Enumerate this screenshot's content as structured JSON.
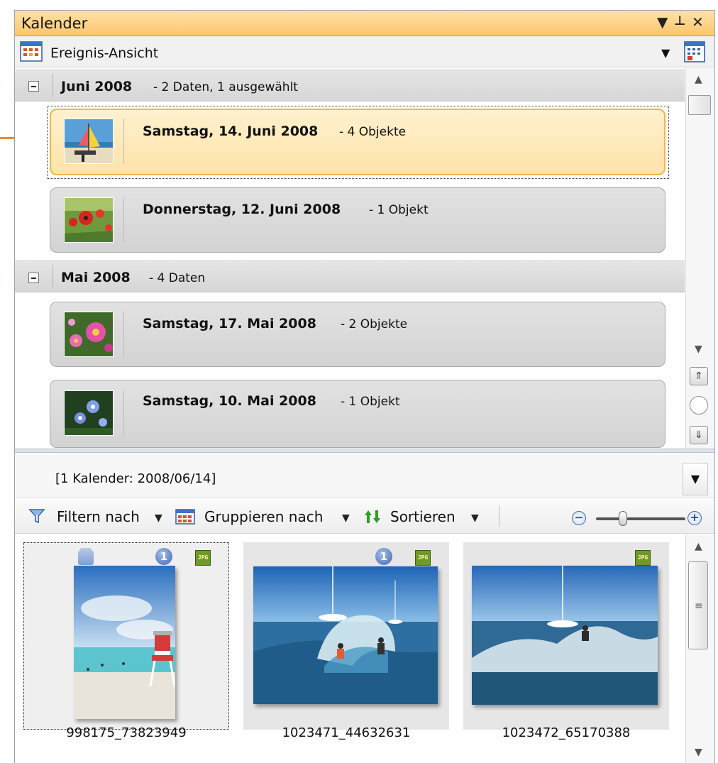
{
  "window": {
    "title": "Kalender",
    "controls": [
      "▼",
      "⊥",
      "✕"
    ]
  },
  "view_selector": {
    "value": "Ereignis-Ansicht"
  },
  "groups": [
    {
      "title": "Juni 2008",
      "summary": "- 2 Daten, 1 ausgewählt",
      "dates": [
        {
          "title": "Samstag, 14. Juni 2008",
          "count": "- 4 Objekte",
          "selected": true,
          "thumb": "beach-sailboat"
        },
        {
          "title": "Donnerstag, 12. Juni 2008",
          "count": "- 1 Objekt",
          "selected": false,
          "thumb": "red-poppies"
        }
      ]
    },
    {
      "title": "Mai 2008",
      "summary": "- 4 Daten",
      "dates": [
        {
          "title": "Samstag, 17. Mai 2008",
          "count": "- 2 Objekte",
          "selected": false,
          "thumb": "pink-flowers"
        },
        {
          "title": "Samstag, 10. Mai 2008",
          "count": "- 1 Objekt",
          "selected": false,
          "thumb": "blue-flowers"
        }
      ]
    }
  ],
  "filter": {
    "value": "[1 Kalender: 2008/06/14]"
  },
  "toolbar": {
    "filter_label": "Filtern nach",
    "group_label": "Gruppieren nach",
    "sort_label": "Sortieren",
    "zoom_minus": "−",
    "zoom_plus": "+"
  },
  "files": [
    {
      "name": "998175_73823949",
      "type": "JPG",
      "has_info": true,
      "has_tag": true,
      "selected": true
    },
    {
      "name": "1023471_44632631",
      "type": "JPG",
      "has_info": true,
      "has_tag": false,
      "selected": false
    },
    {
      "name": "1023472_65170388",
      "type": "JPG",
      "has_info": false,
      "has_tag": false,
      "selected": false
    }
  ],
  "colors": {
    "title_bar": "#fcc66c",
    "selection_fill": "#ffe3a8",
    "selection_border": "#f4b44a",
    "callout": "#e58a3a"
  }
}
